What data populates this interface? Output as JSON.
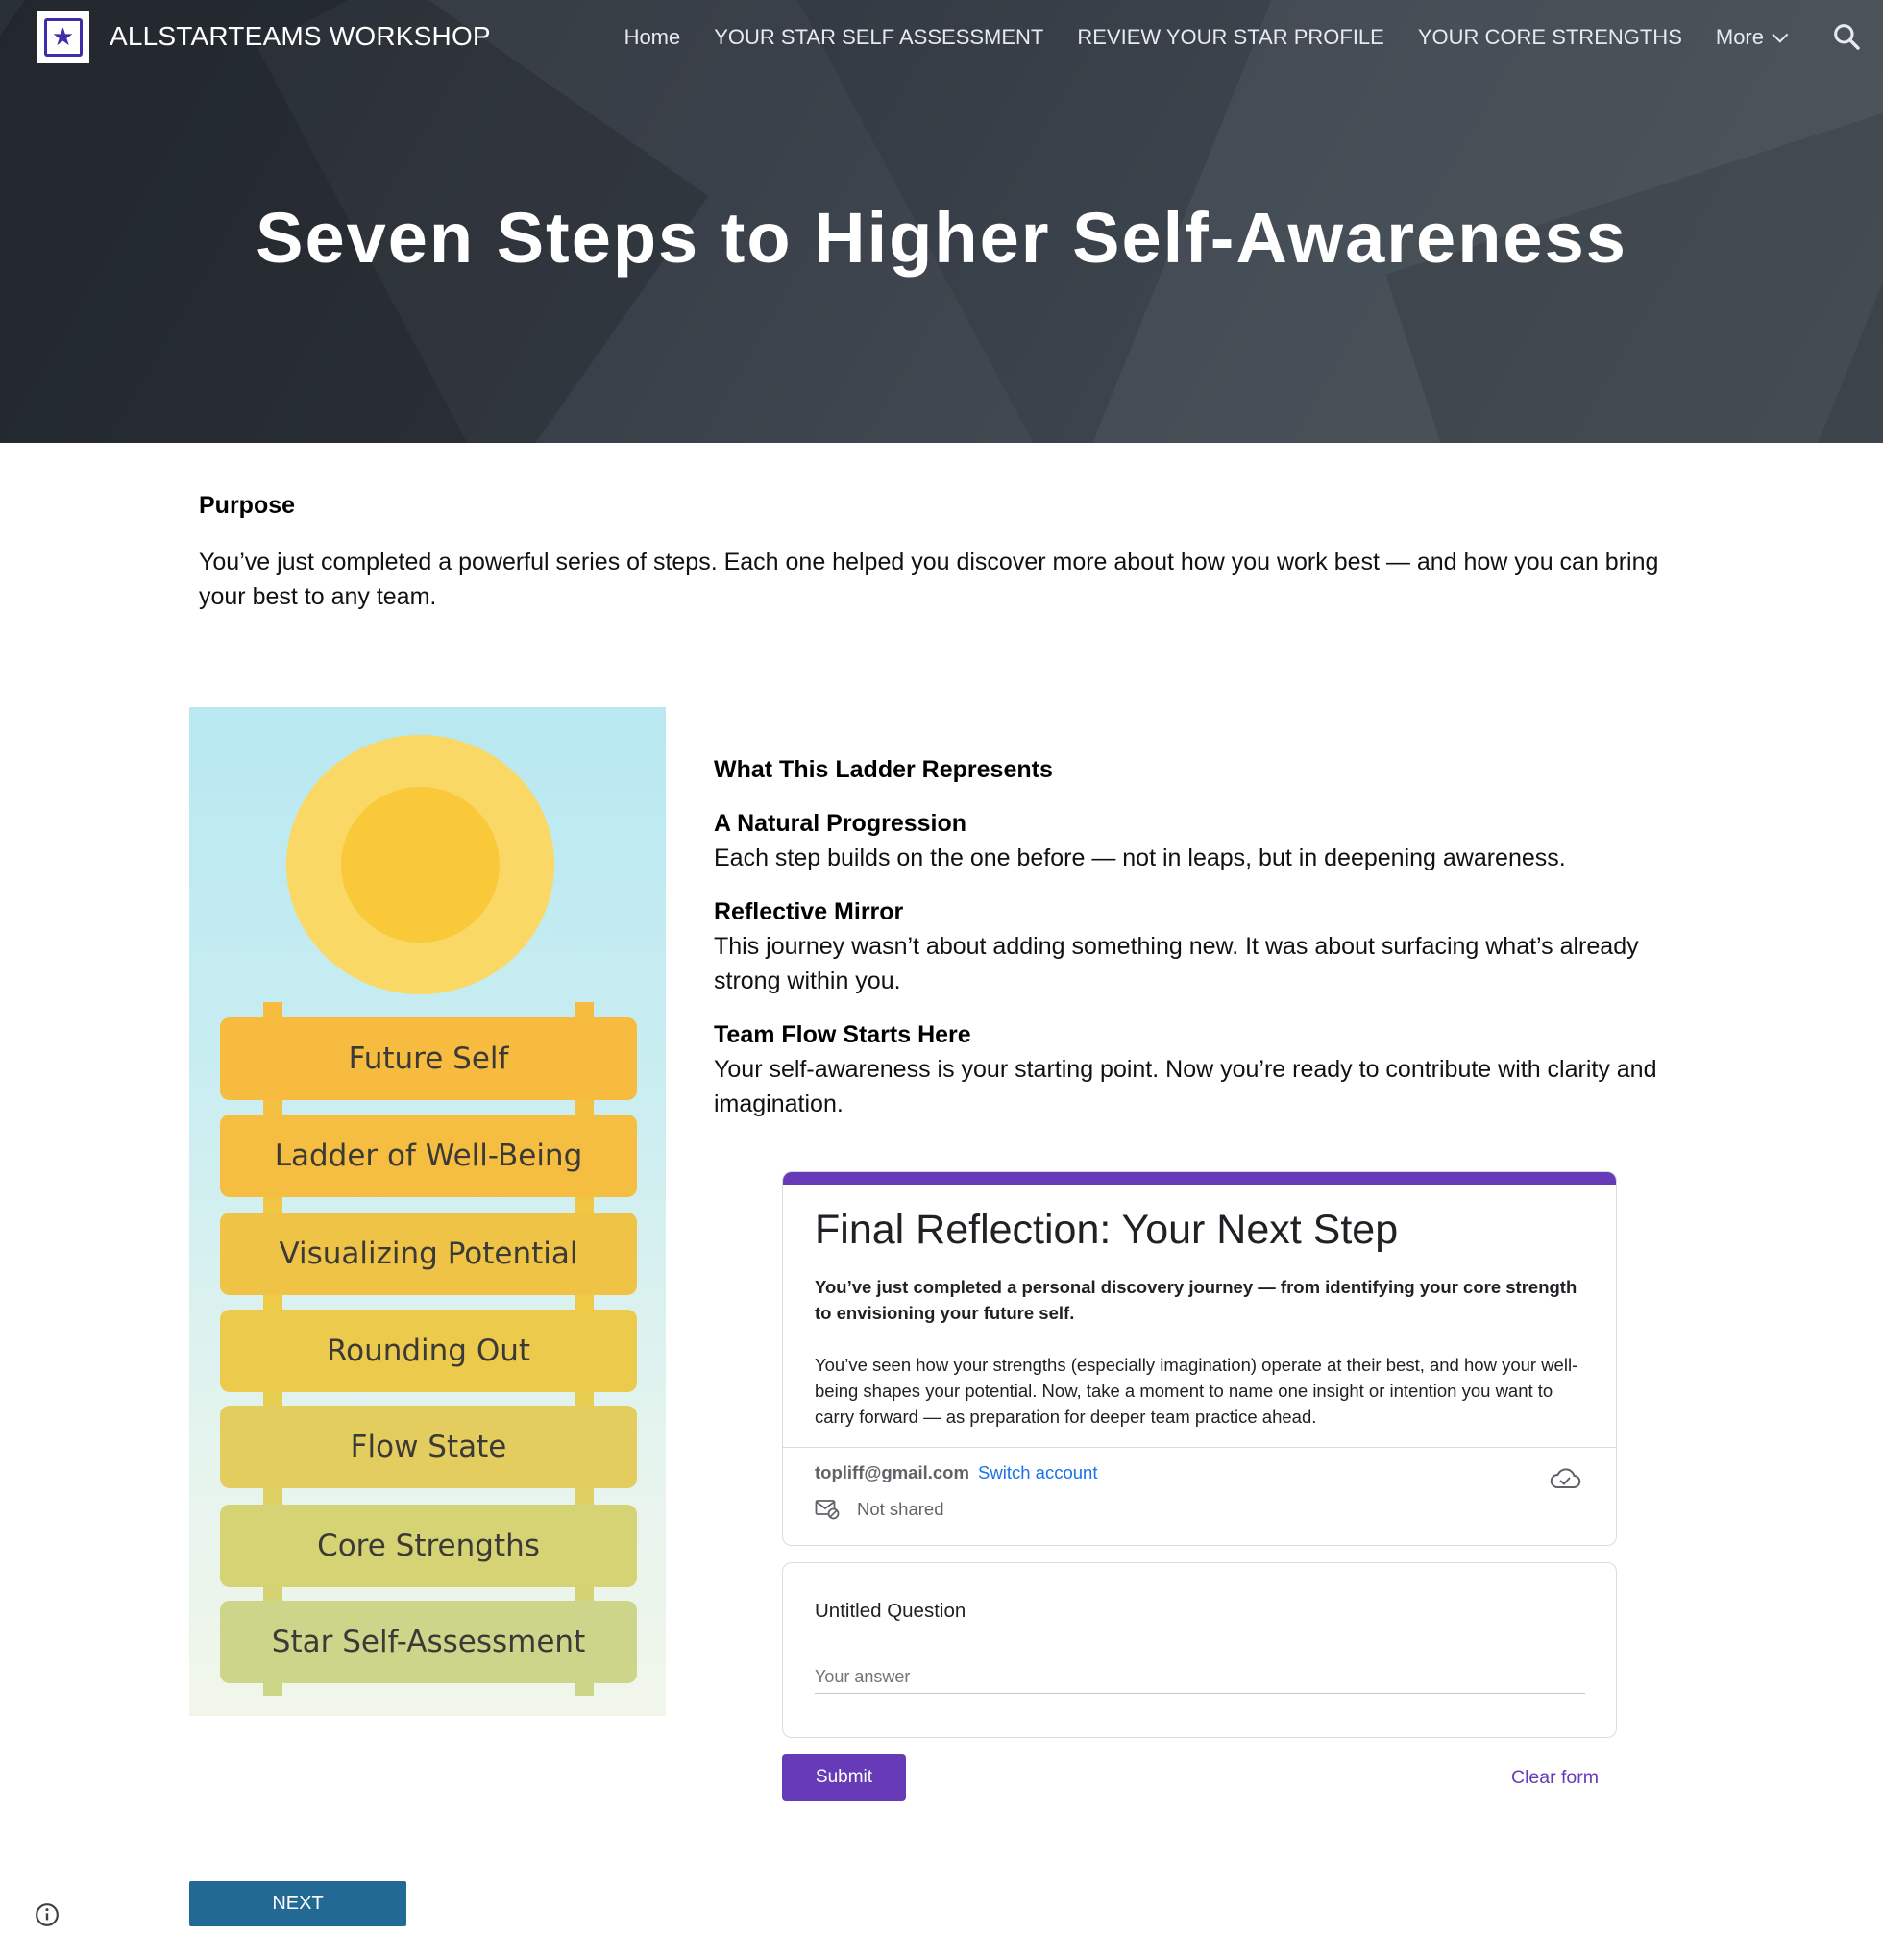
{
  "header": {
    "site_title": "ALLSTARTEAMS WORKSHOP",
    "nav": [
      {
        "label": "Home"
      },
      {
        "label": "YOUR STAR SELF ASSESSMENT"
      },
      {
        "label": "REVIEW YOUR STAR PROFILE"
      },
      {
        "label": "YOUR CORE STRENGTHS"
      },
      {
        "label": "More"
      }
    ],
    "icons": {
      "logo": "star-logo-icon",
      "more": "chevron-down-icon",
      "search": "search-icon"
    }
  },
  "hero": {
    "title": "Seven Steps to Higher Self-Awareness"
  },
  "purpose": {
    "heading": "Purpose",
    "text": "You’ve just completed a powerful series of steps. Each one helped you discover more about how you work best — and how you can bring your best to any team."
  },
  "ladder": {
    "steps": [
      "Future Self",
      "Ladder of Well-Being",
      "Visualizing Potential",
      "Rounding Out",
      "Flow State",
      "Core Strengths",
      "Star Self-Assessment"
    ],
    "colors": {
      "sun_outer": "#fad865",
      "sun_inner": "#f9c93a",
      "rungs": [
        "#f6bb3f",
        "#f6be40",
        "#efc446",
        "#ecca4c",
        "#e2cd5e",
        "#d6d374",
        "#ccd58a"
      ]
    }
  },
  "ladder_info": {
    "heading": "What This Ladder Represents",
    "sections": [
      {
        "title": "A Natural Progression",
        "text": "Each step builds on the one before — not in leaps, but in deepening awareness."
      },
      {
        "title": "Reflective Mirror",
        "text": "This journey wasn’t about adding something new. It was about surfacing what’s already strong within you."
      },
      {
        "title": "Team Flow Starts Here",
        "text": "Your self-awareness is your starting point. Now you’re ready to contribute with clarity and imagination."
      }
    ]
  },
  "form": {
    "accent": "#673ab7",
    "title": "Final Reflection: Your Next Step",
    "bold_text": "You’ve just completed a personal discovery journey — from identifying your core strength to envisioning your future self.",
    "description": "You’ve seen how your strengths (especially imagination) operate at their best, and how your well-being shapes your potential. Now, take a moment to name one insight or intention you want to carry forward — as preparation for deeper team practice ahead.",
    "account_email": "topliff@gmail.com",
    "switch_account": "Switch account",
    "not_shared": "Not shared",
    "question_title": "Untitled Question",
    "answer_placeholder": "Your answer",
    "answer_value": "",
    "submit": "Submit",
    "clear": "Clear form"
  },
  "footer": {
    "next": "NEXT"
  }
}
